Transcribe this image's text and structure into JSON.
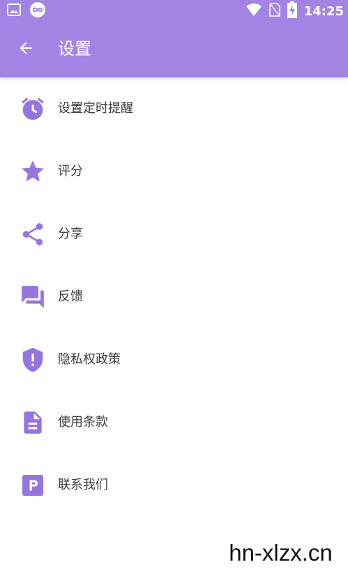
{
  "status_bar": {
    "time": "14:25"
  },
  "toolbar": {
    "title": "设置"
  },
  "menu": {
    "items": [
      {
        "label": "设置定时提醒",
        "icon": "alarm-icon"
      },
      {
        "label": "评分",
        "icon": "star-icon"
      },
      {
        "label": "分享",
        "icon": "share-icon"
      },
      {
        "label": "反馈",
        "icon": "feedback-icon"
      },
      {
        "label": "隐私权政策",
        "icon": "shield-icon"
      },
      {
        "label": "使用条款",
        "icon": "document-icon"
      },
      {
        "label": "联系我们",
        "icon": "parking-icon"
      }
    ]
  },
  "watermark": {
    "text": "hn-xlzx.cn"
  },
  "colors": {
    "accent": "#a383e3",
    "icon": "#9575e0",
    "text": "#3a3a3a"
  }
}
